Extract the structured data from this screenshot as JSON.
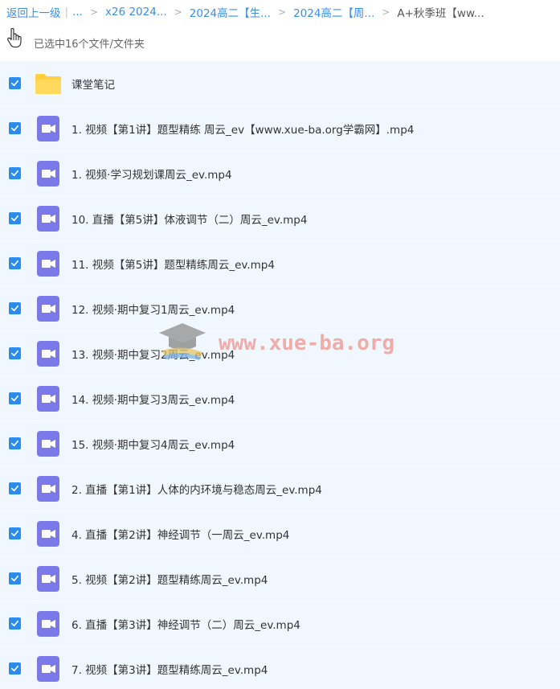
{
  "breadcrumb": {
    "back": "返回上一级",
    "ellipsis": "...",
    "items": [
      "x26 2024...",
      "2024高二【生...",
      "2024高二【周...",
      "A+秋季班【ww..."
    ]
  },
  "status": {
    "selection": "已选中16个文件/文件夹"
  },
  "watermark": {
    "text": "www.xue-ba.org"
  },
  "colors": {
    "checkbox": "#2a8ded",
    "folder": "#ffcf40",
    "video": "#7b79ea",
    "row_bg": "#f1f7fe",
    "link": "#3a8ee6"
  },
  "files": [
    {
      "name": "课堂笔记",
      "icon": "folder-icon",
      "checked": true
    },
    {
      "name": "1. 视频【第1讲】题型精练 周云_ev【www.xue-ba.org学霸网】.mp4",
      "icon": "video-file-icon",
      "checked": true
    },
    {
      "name": "1. 视频·学习规划课周云_ev.mp4",
      "icon": "video-file-icon",
      "checked": true
    },
    {
      "name": "10. 直播【第5讲】体液调节（二）周云_ev.mp4",
      "icon": "video-file-icon",
      "checked": true
    },
    {
      "name": "11. 视频【第5讲】题型精练周云_ev.mp4",
      "icon": "video-file-icon",
      "checked": true
    },
    {
      "name": "12. 视频·期中复习1周云_ev.mp4",
      "icon": "video-file-icon",
      "checked": true
    },
    {
      "name": "13. 视频·期中复习2周云_ev.mp4",
      "icon": "video-file-icon",
      "checked": true
    },
    {
      "name": "14. 视频·期中复习3周云_ev.mp4",
      "icon": "video-file-icon",
      "checked": true
    },
    {
      "name": "15. 视频·期中复习4周云_ev.mp4",
      "icon": "video-file-icon",
      "checked": true
    },
    {
      "name": "2. 直播【第1讲】人体的内环境与稳态周云_ev.mp4",
      "icon": "video-file-icon",
      "checked": true
    },
    {
      "name": "4. 直播【第2讲】神经调节（一周云_ev.mp4",
      "icon": "video-file-icon",
      "checked": true
    },
    {
      "name": "5. 视频【第2讲】题型精练周云_ev.mp4",
      "icon": "video-file-icon",
      "checked": true
    },
    {
      "name": "6. 直播【第3讲】神经调节（二）周云_ev.mp4",
      "icon": "video-file-icon",
      "checked": true
    },
    {
      "name": "7. 视频【第3讲】题型精练周云_ev.mp4",
      "icon": "video-file-icon",
      "checked": true
    }
  ]
}
